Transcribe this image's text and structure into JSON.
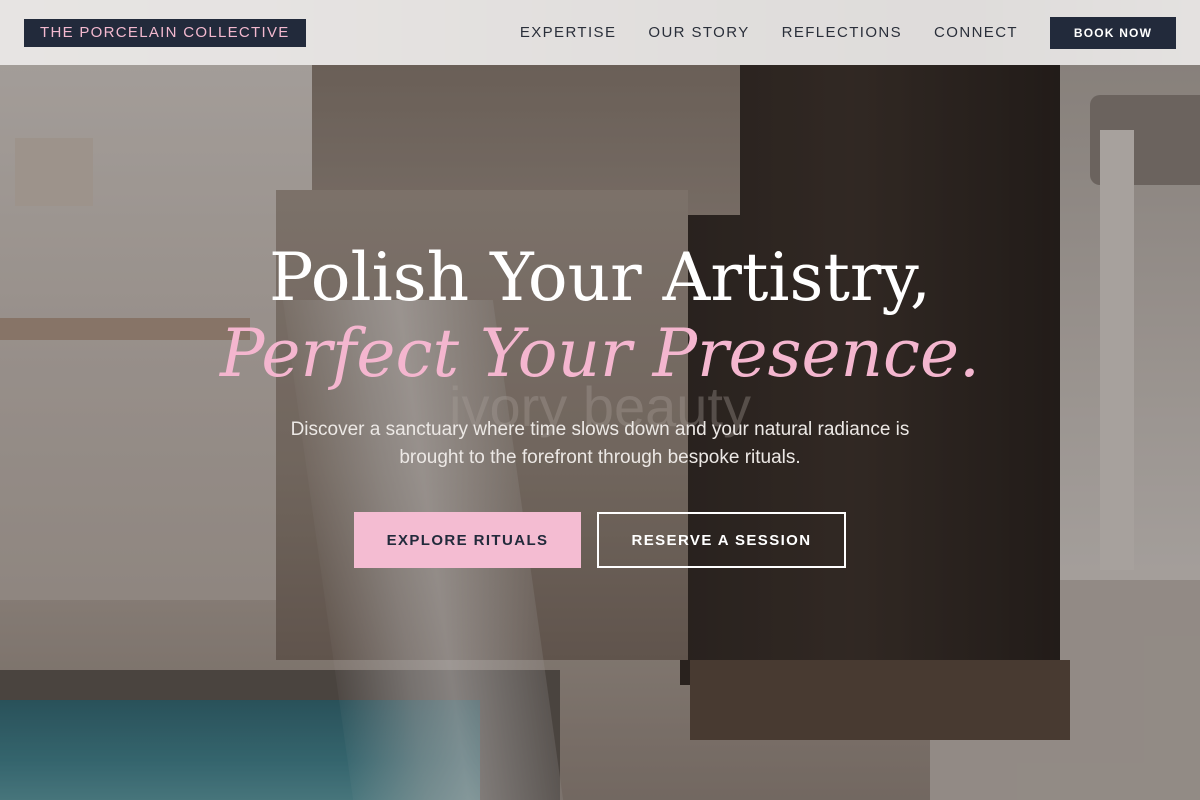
{
  "nav": {
    "logo": "THE PORCELAIN COLLECTIVE",
    "links": [
      "EXPERTISE",
      "OUR STORY",
      "REFLECTIONS",
      "CONNECT"
    ],
    "cta": "BOOK NOW"
  },
  "hero": {
    "headline_line1": "Polish Your Artistry,",
    "headline_line2": "Perfect Your Presence.",
    "background_text": "ivory beauty",
    "subtext": "Discover a sanctuary where time slows down and your natural radiance is brought to the forefront through bespoke rituals.",
    "primary_button": "EXPLORE RITUALS",
    "secondary_button": "RESERVE A SESSION"
  },
  "colors": {
    "navy": "#222a3b",
    "pink": "#f4bcd2",
    "white": "#ffffff"
  }
}
